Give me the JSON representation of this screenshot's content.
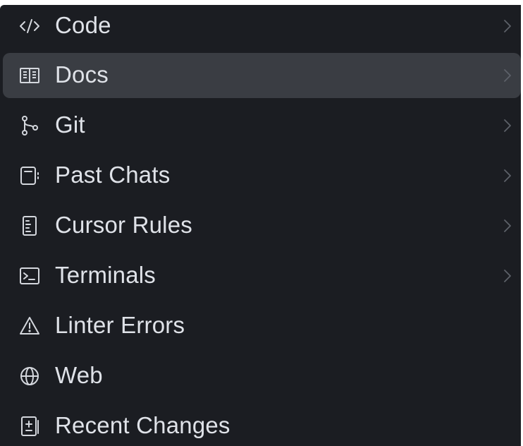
{
  "colors": {
    "menu_bg": "#1b1d22",
    "selected_bg": "#3a3d43",
    "text": "#dfe2e8",
    "icon": "#d4d7dd",
    "chevron": "#5d6169"
  },
  "menu": {
    "items": [
      {
        "label": "Code",
        "icon": "code-icon",
        "has_submenu": true
      },
      {
        "label": "Docs",
        "icon": "book-icon",
        "has_submenu": true,
        "selected": true
      },
      {
        "label": "Git",
        "icon": "git-branch-icon",
        "has_submenu": true
      },
      {
        "label": "Past Chats",
        "icon": "notebook-icon",
        "has_submenu": true
      },
      {
        "label": "Cursor Rules",
        "icon": "rules-file-icon",
        "has_submenu": true
      },
      {
        "label": "Terminals",
        "icon": "terminal-icon",
        "has_submenu": true
      },
      {
        "label": "Linter Errors",
        "icon": "warning-icon",
        "has_submenu": false
      },
      {
        "label": "Web",
        "icon": "globe-icon",
        "has_submenu": false
      },
      {
        "label": "Recent Changes",
        "icon": "diff-icon",
        "has_submenu": false
      }
    ]
  }
}
